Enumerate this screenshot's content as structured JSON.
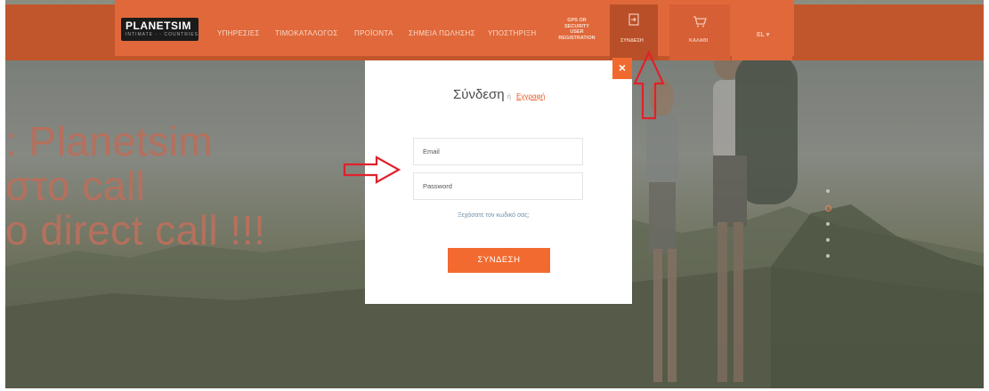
{
  "brand": {
    "logo_text": "PLANETSIM",
    "logo_sub": "INTIMATE · · COUNTRIES"
  },
  "nav": {
    "items": [
      "ΥΠΗΡΕΣΙΕΣ",
      "ΤΙΜΟΚΑΤΑΛΟΓΟΣ",
      "ΠΡΟΪΟΝΤΑ",
      "ΣΗΜΕΙΑ ΠΩΛΗΣΗΣ",
      "ΥΠΟΣΤΗΡΙΞΗ"
    ],
    "gps_lines": [
      "GPS OR",
      "SECURITY",
      "USER",
      "REGISTRATION"
    ],
    "login_label": "ΣΥΝΔΕΣΗ",
    "cart_label": "ΚΑΛΑΘΙ",
    "language": "EL ▾",
    "login_icon": "login-icon",
    "cart_icon": "cart-icon"
  },
  "hero": {
    "lines": [
      ": Planetsim",
      "στο call",
      "o direct call !!!"
    ]
  },
  "modal": {
    "title": "Σύνδεση",
    "or": "ή",
    "register_link": "Εγγραφή",
    "email_placeholder": "Email",
    "password_placeholder": "Password",
    "forgot_link": "Ξεχάσατε τον κωδικό σας;",
    "submit_label": "ΣΥΝΔΕΣΗ",
    "close_label": "×"
  },
  "colors": {
    "accent": "#f26a2f",
    "nav": "#e0683a",
    "nav_dark": "#c1562d",
    "arrow": "#e0212a"
  }
}
